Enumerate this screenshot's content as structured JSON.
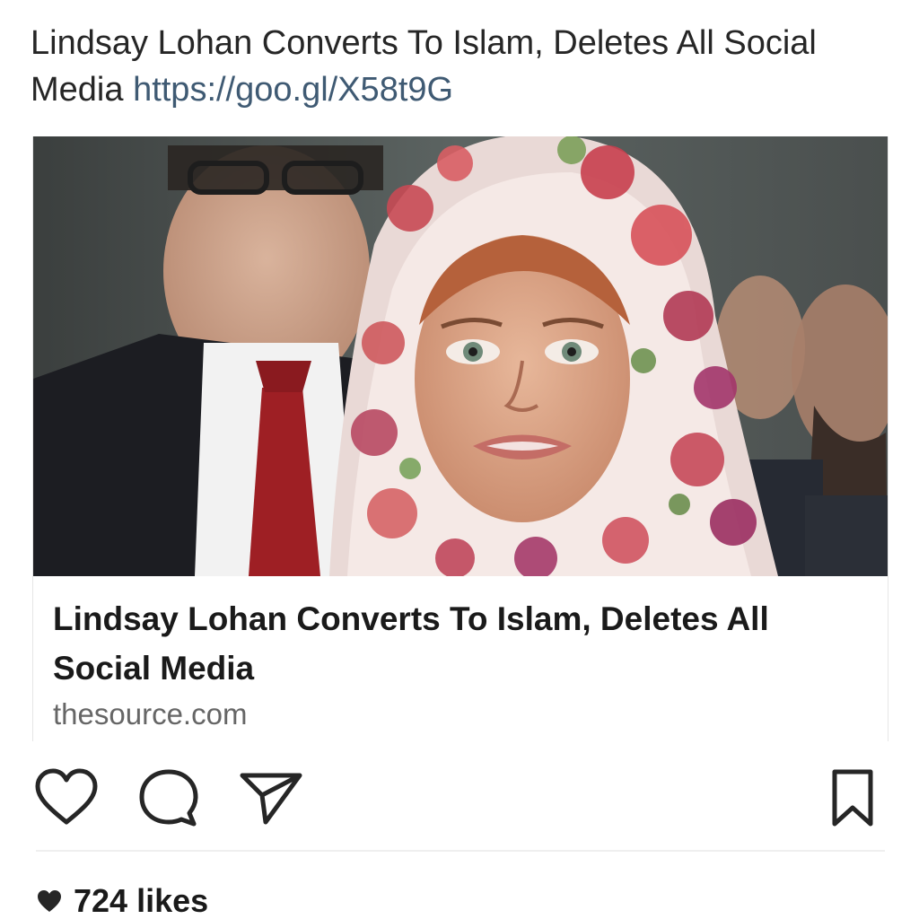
{
  "post": {
    "caption": {
      "text": "Lindsay Lohan Converts To Islam, Deletes All Social Media",
      "link": "https://goo.gl/X58t9G"
    },
    "link_preview": {
      "image_icon": "news-photo",
      "title": "Lindsay Lohan Converts To Islam, Deletes All Social Media",
      "domain": "thesource.com"
    },
    "actions": {
      "like_icon": "heart-outline-icon",
      "comment_icon": "comment-bubble-icon",
      "share_icon": "paper-plane-icon",
      "save_icon": "bookmark-icon"
    },
    "likes": {
      "icon": "heart-filled-icon",
      "count_label": "724 likes"
    }
  },
  "colors": {
    "text": "#262626",
    "link": "#3f5a73",
    "domain": "#666666",
    "divider": "#efefef"
  }
}
